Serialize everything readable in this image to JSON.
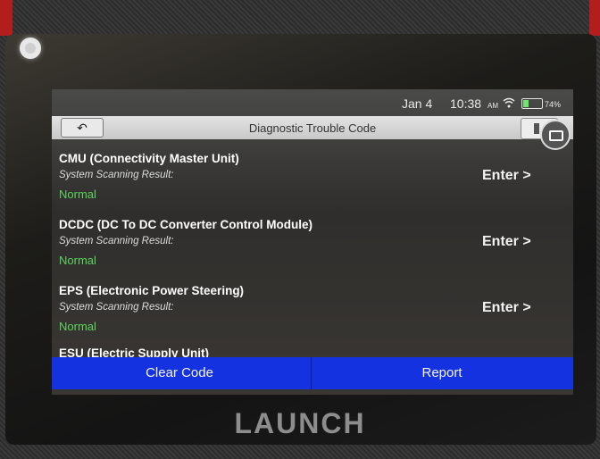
{
  "status": {
    "date": "Jan 4",
    "time": "10:38",
    "ampm": "AM",
    "battery": "74%"
  },
  "header": {
    "back_icon": "↶",
    "title": "Diagnostic Trouble Code"
  },
  "modules": [
    {
      "name": "CMU (Connectivity Master Unit)",
      "scan_label": "System Scanning Result:",
      "result": "Normal",
      "action": "Enter >"
    },
    {
      "name": "DCDC (DC To DC Converter Control Module)",
      "scan_label": "System Scanning Result:",
      "result": "Normal",
      "action": "Enter >"
    },
    {
      "name": "EPS (Electronic Power Steering)",
      "scan_label": "System Scanning Result:",
      "result": "Normal",
      "action": "Enter >"
    },
    {
      "name": "ESU (Electric Supply Unit)"
    }
  ],
  "footer": {
    "clear_label": "Clear Code",
    "report_label": "Report"
  },
  "brand": "LAUNCH",
  "colors": {
    "accent": "#1532e0",
    "normal_status": "#5ed35e"
  },
  "icons": [
    "back-arrow-icon",
    "wifi-icon",
    "battery-icon",
    "flag-icon",
    "camera-icon"
  ]
}
